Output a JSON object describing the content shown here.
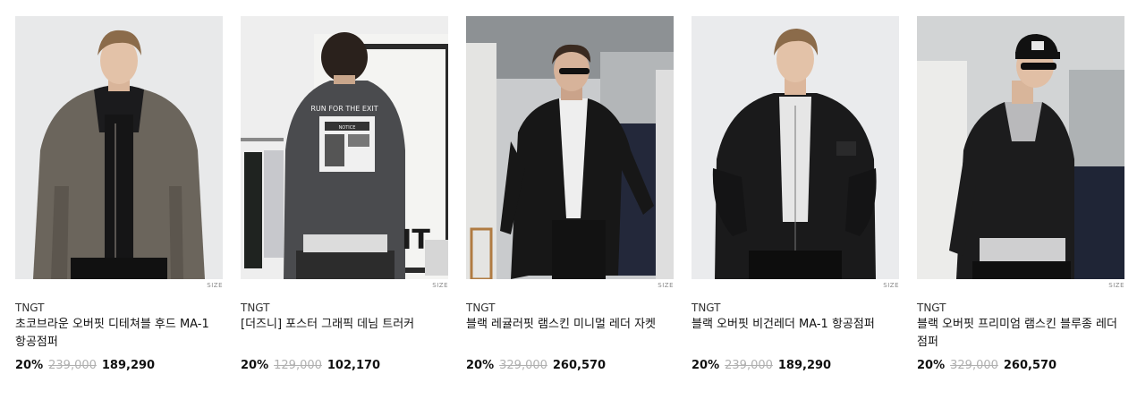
{
  "products": [
    {
      "brand": "TNGT",
      "name": "초코브라운 오버핏 디테쳐블 후드 MA-1 항공점퍼",
      "discount": "20%",
      "original_price": "239,000",
      "price": "189,290",
      "size_label": "SIZE"
    },
    {
      "brand": "TNGT",
      "name": "[더즈니] 포스터 그래픽 데님 트러커",
      "discount": "20%",
      "original_price": "129,000",
      "price": "102,170",
      "size_label": "SIZE",
      "image_texts": [
        "RUN FOR THE EXIT",
        "NOTICE",
        "IT"
      ]
    },
    {
      "brand": "TNGT",
      "name": "블랙 레귤러핏 램스킨 미니멀 레더 자켓",
      "discount": "20%",
      "original_price": "329,000",
      "price": "260,570",
      "size_label": "SIZE"
    },
    {
      "brand": "TNGT",
      "name": "블랙 오버핏 비건레더 MA-1 항공점퍼",
      "discount": "20%",
      "original_price": "239,000",
      "price": "189,290",
      "size_label": "SIZE"
    },
    {
      "brand": "TNGT",
      "name": "블랙 오버핏 프리미엄 램스킨 블루종 레더 점퍼",
      "discount": "20%",
      "original_price": "329,000",
      "price": "260,570",
      "size_label": "SIZE"
    }
  ]
}
